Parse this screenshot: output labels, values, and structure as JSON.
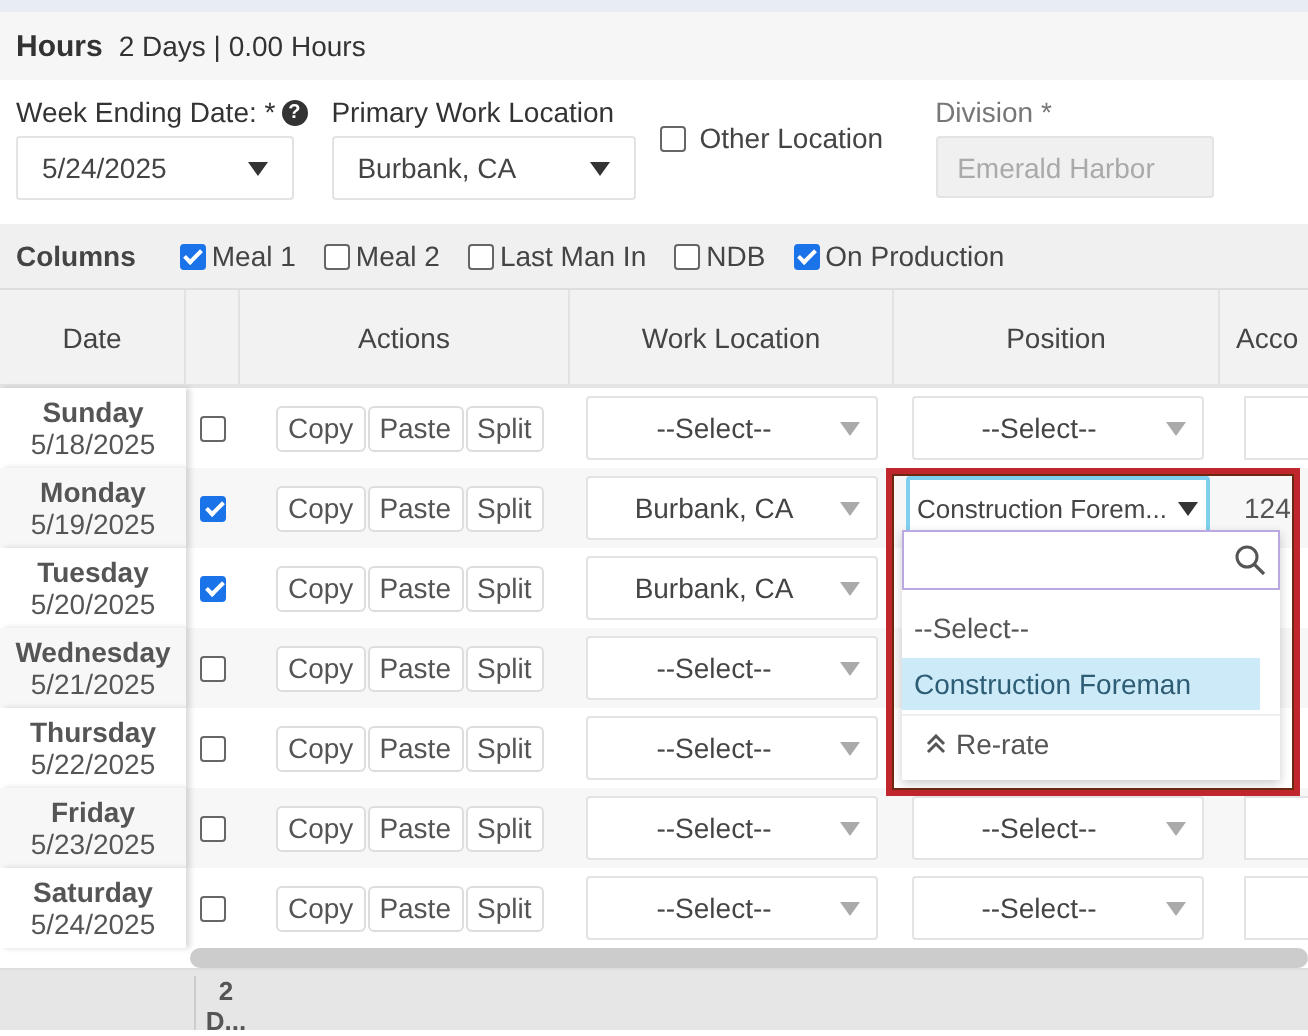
{
  "header": {
    "title": "Hours",
    "summary": "2 Days | 0.00 Hours"
  },
  "filters": {
    "week_ending": {
      "label": "Week Ending Date:",
      "required": "*",
      "help": "?",
      "value": "5/24/2025"
    },
    "primary_location": {
      "label": "Primary Work Location",
      "value": "Burbank, CA"
    },
    "other_location": {
      "label": "Other Location",
      "checked": false
    },
    "division": {
      "label": "Division",
      "required": "*",
      "placeholder": "Emerald Harbor",
      "disabled": true
    }
  },
  "columns_bar": {
    "label": "Columns",
    "options": [
      {
        "label": "Meal 1",
        "checked": true
      },
      {
        "label": "Meal 2",
        "checked": false
      },
      {
        "label": "Last Man In",
        "checked": false
      },
      {
        "label": "NDB",
        "checked": false
      },
      {
        "label": "On Production",
        "checked": true
      }
    ]
  },
  "table": {
    "columns": [
      "Date",
      "Actions",
      "Work Location",
      "Position",
      "Acco"
    ],
    "rows": [
      {
        "day": "Sunday",
        "date": "5/18/2025",
        "checked": false,
        "actions": [
          "Copy",
          "Paste",
          "Split"
        ],
        "work_location": "--Select--",
        "position": "--Select--",
        "position_open": false,
        "account": ""
      },
      {
        "day": "Monday",
        "date": "5/19/2025",
        "checked": true,
        "actions": [
          "Copy",
          "Paste",
          "Split"
        ],
        "work_location": "Burbank, CA",
        "position": "Construction Forem...",
        "position_open": true,
        "account": "124"
      },
      {
        "day": "Tuesday",
        "date": "5/20/2025",
        "checked": true,
        "actions": [
          "Copy",
          "Paste",
          "Split"
        ],
        "work_location": "Burbank, CA"
      },
      {
        "day": "Wednesday",
        "date": "5/21/2025",
        "checked": false,
        "actions": [
          "Copy",
          "Paste",
          "Split"
        ],
        "work_location": "--Select--"
      },
      {
        "day": "Thursday",
        "date": "5/22/2025",
        "checked": false,
        "actions": [
          "Copy",
          "Paste",
          "Split"
        ],
        "work_location": "--Select--"
      },
      {
        "day": "Friday",
        "date": "5/23/2025",
        "checked": false,
        "actions": [
          "Copy",
          "Paste",
          "Split"
        ],
        "work_location": "--Select--",
        "position": "--Select--",
        "position_open": false
      },
      {
        "day": "Saturday",
        "date": "5/24/2025",
        "checked": false,
        "actions": [
          "Copy",
          "Paste",
          "Split"
        ],
        "work_location": "--Select--",
        "position": "--Select--",
        "position_open": false
      }
    ],
    "footer": "2 D..."
  },
  "position_dropdown": {
    "options": [
      {
        "label": "--Select--",
        "selected": false
      },
      {
        "label": "Construction Foreman",
        "selected": true
      }
    ],
    "action": "Re-rate"
  }
}
